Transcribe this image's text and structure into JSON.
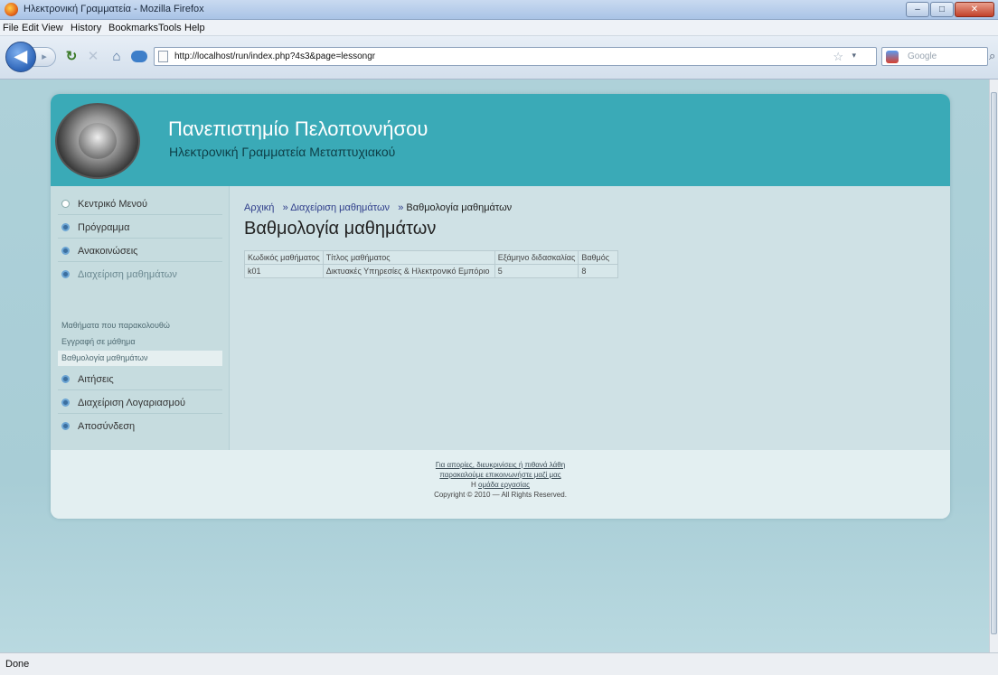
{
  "window": {
    "title": "Ηλεκτρονική Γραμματεία - Mozilla Firefox",
    "min": "–",
    "max": "□",
    "close": "✕"
  },
  "menu": [
    "File",
    "Edit",
    "View",
    "History",
    "Bookmarks",
    "Tools",
    "Help"
  ],
  "nav": {
    "url": "http://localhost/run/index.php?4s3&page=lessongr",
    "search_placeholder": "Google",
    "icons": [
      "back-icon",
      "forward-icon",
      "reload-icon",
      "stop-icon",
      "home-icon",
      "search-icon"
    ]
  },
  "header": {
    "title": "Πανεπιστημίο Πελοποννήσου",
    "subtitle": "Ηλεκτρονική Γραμματεία Μεταπτυχιακού"
  },
  "sidebar": {
    "items": [
      {
        "label": "Κεντρικό Μενού"
      },
      {
        "label": "Πρόγραμμα"
      },
      {
        "label": "Ανακοινώσεις"
      },
      {
        "label": "Διαχείριση μαθημάτων"
      }
    ],
    "subitems": [
      {
        "label": "Μαθήματα που παρακολουθώ"
      },
      {
        "label": "Εγγραφή σε μάθημα"
      },
      {
        "label": "Βαθμολογία μαθημάτων"
      }
    ],
    "items2": [
      {
        "label": "Αιτήσεις"
      },
      {
        "label": "Διαχείριση Λογαριασμού"
      },
      {
        "label": "Αποσύνδεση"
      }
    ]
  },
  "breadcrumb": {
    "home": "Αρχική",
    "sep": "»",
    "level1": "Διαχείριση μαθημάτων",
    "current": "Βαθμολογία μαθημάτων"
  },
  "page_title": "Βαθμολογία μαθημάτων",
  "table": {
    "headers": [
      "Κωδικός μαθήματος",
      "Τίτλος μαθήματος",
      "Εξάμηνο διδασκαλίας",
      "Βαθμός"
    ],
    "rows": [
      [
        "k01",
        "Δικτυακές Υπηρεσίες & Ηλεκτρονικό Εμπόριο",
        "5",
        "8"
      ]
    ]
  },
  "footer": {
    "line1": "Για απορίες, διευκρινίσεις ή πιθανά λάθη",
    "line2": "παρακαλούμε επικοινωνήστε μαζί μας",
    "line3_prefix": "Η",
    "line3_link": "ομάδα εργασίας",
    "copyright": "Copyright © 2010 — All Rights Reserved."
  },
  "status": "Done"
}
